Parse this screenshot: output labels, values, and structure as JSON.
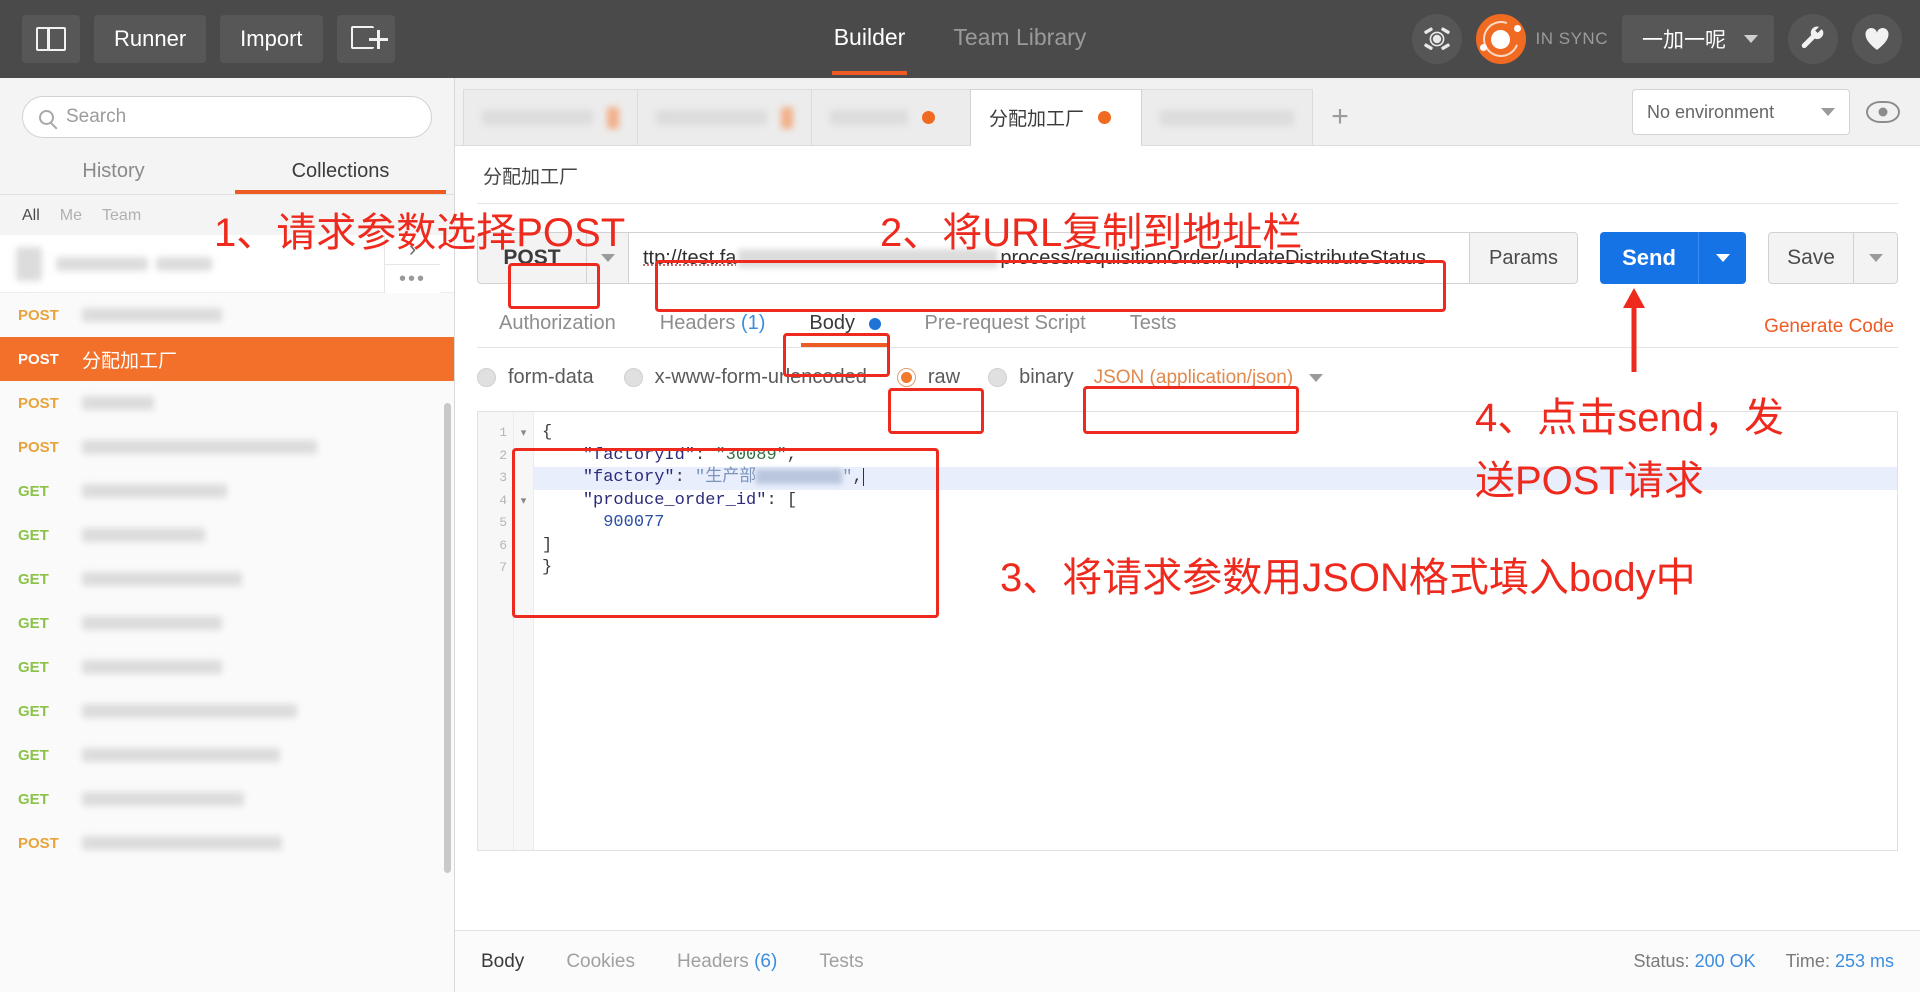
{
  "header": {
    "buttons": [
      {
        "name": "toggle-sidebar",
        "label": ""
      },
      {
        "name": "runner",
        "label": "Runner"
      },
      {
        "name": "import",
        "label": "Import"
      },
      {
        "name": "new-tab",
        "label": ""
      }
    ],
    "runner_label": "Runner",
    "import_label": "Import",
    "tabs": [
      {
        "label": "Builder",
        "active": true
      },
      {
        "label": "Team Library",
        "active": false
      }
    ],
    "builder_label": "Builder",
    "team_library_label": "Team Library",
    "sync_label": "IN SYNC",
    "user_name": "一加一呢",
    "accent": "#ef5b25"
  },
  "sidebar": {
    "search_placeholder": "Search",
    "search_value": "",
    "tabs": [
      {
        "label": "History",
        "active": false
      },
      {
        "label": "Collections",
        "active": true
      }
    ],
    "history_label": "History",
    "collections_label": "Collections",
    "filters": [
      "All",
      "Me",
      "Team"
    ],
    "filter_all": "All",
    "filter_me": "Me",
    "filter_team": "Team",
    "requests": [
      {
        "method": "POST",
        "name": "",
        "selected": false
      },
      {
        "method": "POST",
        "name": "分配加工厂",
        "selected": true
      },
      {
        "method": "POST",
        "name": "",
        "selected": false
      },
      {
        "method": "POST",
        "name": "",
        "selected": false
      },
      {
        "method": "GET",
        "name": "",
        "selected": false
      },
      {
        "method": "GET",
        "name": "",
        "selected": false
      },
      {
        "method": "GET",
        "name": "",
        "selected": false
      },
      {
        "method": "GET",
        "name": "",
        "selected": false
      },
      {
        "method": "GET",
        "name": "",
        "selected": false
      },
      {
        "method": "GET",
        "name": "",
        "selected": false
      },
      {
        "method": "GET",
        "name": "",
        "selected": false
      },
      {
        "method": "GET",
        "name": "",
        "selected": false
      },
      {
        "method": "POST",
        "name": "",
        "selected": false
      }
    ]
  },
  "tabbar": {
    "tabs": [
      {
        "label": "",
        "active": false,
        "unsaved": false
      },
      {
        "label": "",
        "active": false,
        "unsaved": false
      },
      {
        "label": "",
        "active": false,
        "unsaved": true
      },
      {
        "label": "分配加工厂",
        "active": true,
        "unsaved": true
      },
      {
        "label": "",
        "active": false,
        "unsaved": false
      }
    ],
    "active_tab_label": "分配加工厂",
    "add_tab_label": "+",
    "environment_label": "No environment"
  },
  "request": {
    "breadcrumb": "分配加工厂",
    "method": "POST",
    "url_prefix": "ttp://test.fa",
    "url_suffix": "process/requisitionOrder/updateDistributeStatus",
    "params_label": "Params",
    "send_label": "Send",
    "save_label": "Save",
    "tabs": [
      {
        "label": "Authorization",
        "active": false
      },
      {
        "label": "Headers",
        "count": "(1)",
        "active": false
      },
      {
        "label": "Body",
        "active": true,
        "dot": true
      },
      {
        "label": "Pre-request Script",
        "active": false
      },
      {
        "label": "Tests",
        "active": false
      }
    ],
    "tab_authorization": "Authorization",
    "tab_headers": "Headers",
    "tab_headers_count": "(1)",
    "tab_body": "Body",
    "tab_prerequest": "Pre-request Script",
    "tab_tests": "Tests",
    "generate_code_label": "Generate Code",
    "body_types": [
      {
        "label": "form-data",
        "selected": false
      },
      {
        "label": "x-www-form-urlencoded",
        "selected": false
      },
      {
        "label": "raw",
        "selected": true
      },
      {
        "label": "binary",
        "selected": false
      }
    ],
    "bt_formdata": "form-data",
    "bt_urlencoded": "x-www-form-urlencoded",
    "bt_raw": "raw",
    "bt_binary": "binary",
    "content_type": "JSON (application/json)"
  },
  "editor": {
    "line_numbers": [
      "1",
      "2",
      "3",
      "4",
      "5",
      "6",
      "7"
    ],
    "lines": [
      "{",
      "    \"factoryId\": \"30089\",",
      "    \"factory\": \"生产部[…]\",",
      "    \"produce_order_id\": [",
      "        900077",
      "    ]",
      "}"
    ],
    "factory_id_key": "\"factoryId\"",
    "factory_id_value": "\"30089\"",
    "factory_key": "\"factory\"",
    "factory_value_prefix": "\"生产部",
    "produce_order_key": "\"produce_order_id\"",
    "produce_order_value": "900077",
    "open_brace": "{",
    "close_brace": "}",
    "open_bracket": "[",
    "close_bracket": "]",
    "comma": ","
  },
  "response": {
    "tabs": [
      {
        "label": "Body",
        "active": true
      },
      {
        "label": "Cookies",
        "active": false
      },
      {
        "label": "Headers",
        "count": "(6)",
        "active": false
      },
      {
        "label": "Tests",
        "active": false
      }
    ],
    "tab_body": "Body",
    "tab_cookies": "Cookies",
    "tab_headers": "Headers",
    "tab_headers_count": "(6)",
    "tab_tests": "Tests",
    "status_label": "Status:",
    "status_value": "200 OK",
    "time_label": "Time:",
    "time_value": "253 ms"
  },
  "annotations": {
    "step1": "1、请求参数选择POST",
    "step2": "2、将URL复制到地址栏",
    "step3": "3、将请求参数用JSON格式填入body中",
    "step4_line1": "4、点击send，发",
    "step4_line2": "送POST请求",
    "color": "#ee2a1e"
  }
}
